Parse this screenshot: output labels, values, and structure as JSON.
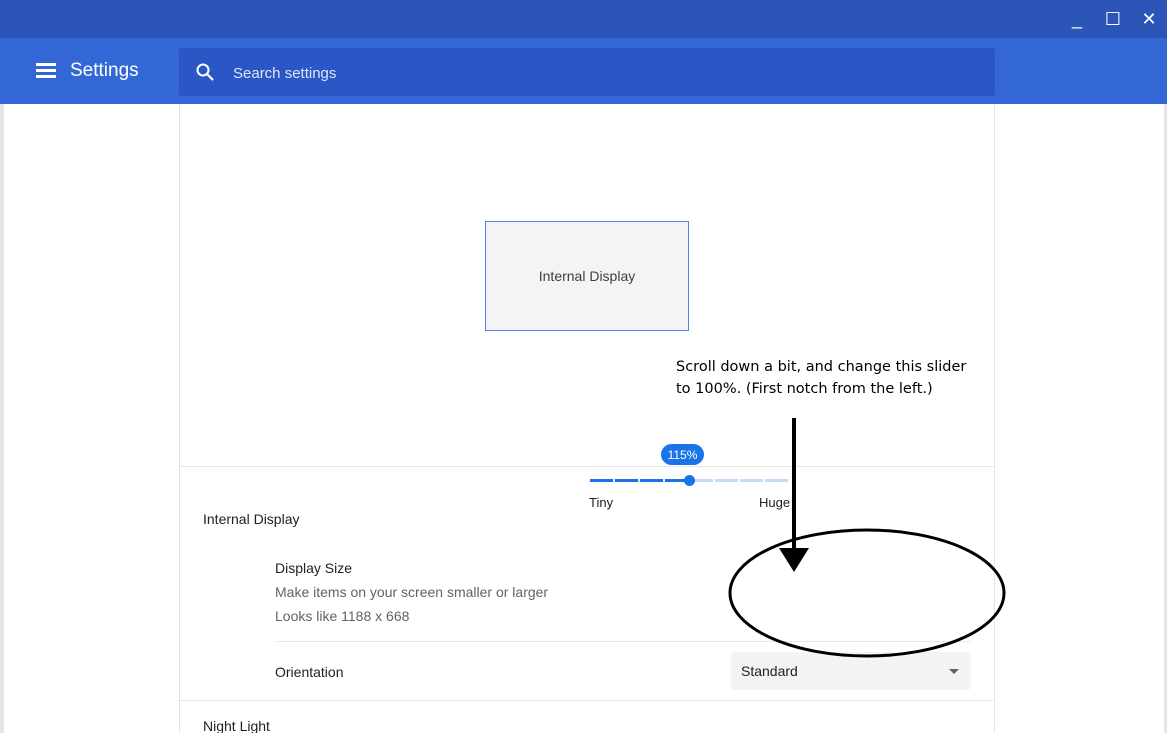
{
  "window": {
    "controls": {
      "minimize": "_",
      "maximize": "☐",
      "close": "✕"
    }
  },
  "header": {
    "title": "Settings",
    "menu_icon": "hamburger-menu-icon",
    "search": {
      "placeholder": "Search settings",
      "value": "",
      "icon": "search-icon"
    }
  },
  "arrangement": {
    "display_label": "Internal Display"
  },
  "internal_display": {
    "section_title": "Internal Display",
    "display_size": {
      "label": "Display Size",
      "description": "Make items on your screen smaller or larger",
      "resolution": "Looks like 1188 x 668",
      "slider": {
        "value_label": "115%",
        "min_label": "Tiny",
        "max_label": "Huge",
        "notch_count": 9,
        "selected_index": 4
      }
    },
    "orientation": {
      "label": "Orientation",
      "value": "Standard",
      "icon": "dropdown-arrow-icon"
    }
  },
  "night_light": {
    "label": "Night Light"
  },
  "annotation": {
    "line1": "Scroll down a bit, and change this slider",
    "line2": "to 100%. (First notch from the left.)"
  },
  "colors": {
    "title_bar": "#2b56b8",
    "app_bar": "#3367d6",
    "accent": "#1a73e8",
    "slider_rest": "#c6dafc"
  }
}
